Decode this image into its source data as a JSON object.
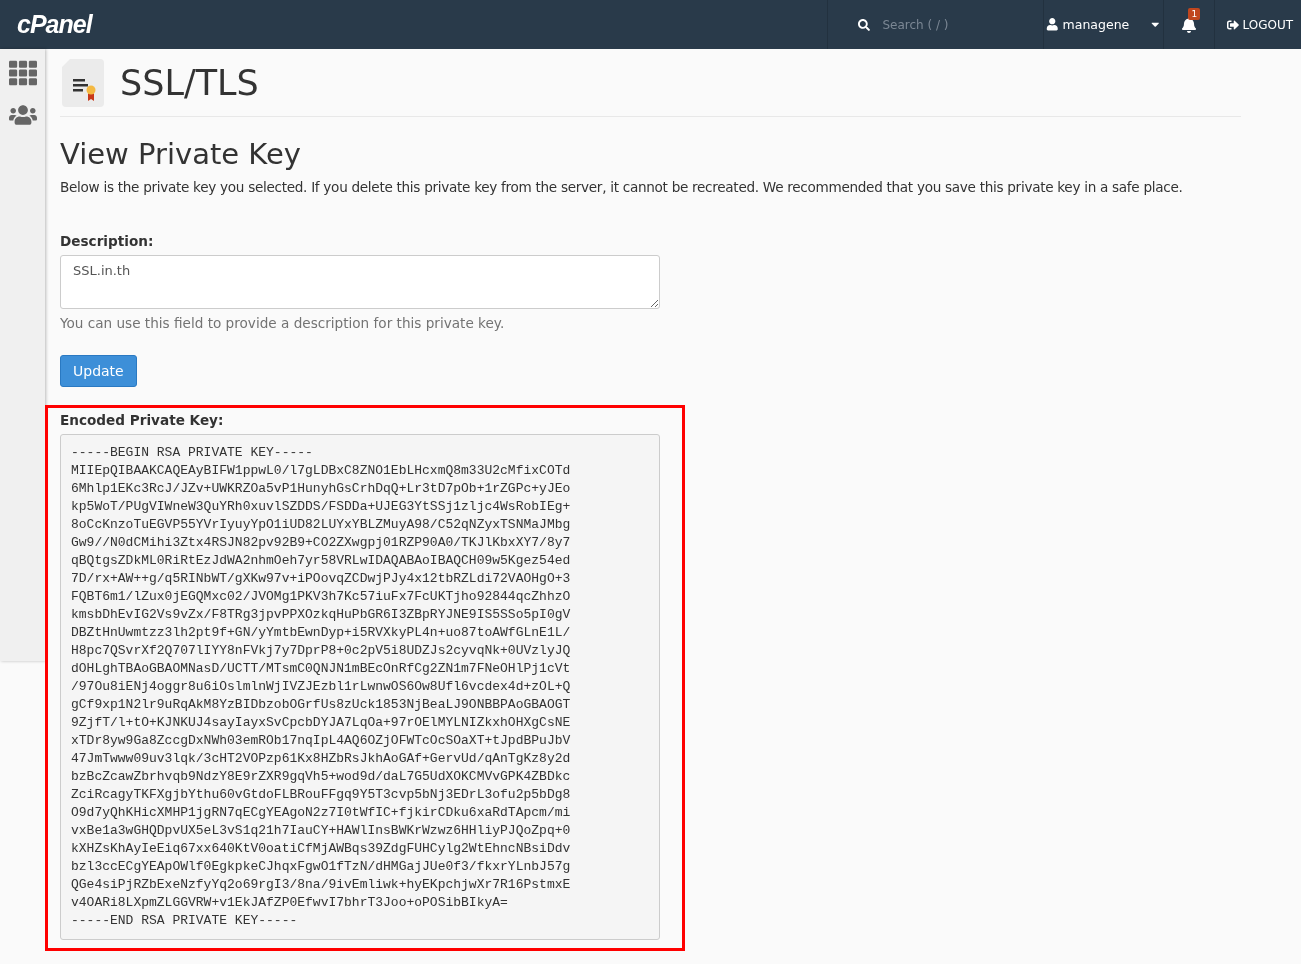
{
  "header": {
    "logo": "cPanel",
    "search": {
      "placeholder": "Search ( / )"
    },
    "user": "managene",
    "notifications": "1",
    "logout": "LOGOUT"
  },
  "sidebar": {
    "items": [
      {
        "kind": "grid",
        "selected": false
      },
      {
        "kind": "users",
        "selected": false
      }
    ]
  },
  "page": {
    "title": "SSL/TLS"
  },
  "section": {
    "title": "View Private Key",
    "intro": "Below is the private key you selected. If you delete this private key from the server, it cannot be recreated. We recommended that you save this private key in a safe place."
  },
  "description": {
    "label": "Description:",
    "value": "SSL.in.th",
    "help": "You can use this field to provide a description for this private key."
  },
  "update_button": "Update",
  "encoded_key": {
    "label": "Encoded Private Key:",
    "highlighted": true,
    "lines": [
      "-----BEGIN RSA PRIVATE KEY-----",
      "MIIEpQIBAAKCAQEAyBIFW1ppwL0/l7gLDBxC8ZNO1EbLHcxmQ8m33U2cMfixCOTd",
      "6Mhlp1EKc3RcJ/JZv+UWKRZOa5vP1HunyhGsCrhDqQ+Lr3tD7pOb+1rZGPc+yJEo",
      "kp5WoT/PUgVIWneW3QuYRh0xuvlSZDDS/FSDDa+UJEG3YtSSj1zljc4WsRobIEg+",
      "8oCcKnzoTuEGVP55YVrIyuyYpO1iUD82LUYxYBLZMuyA98/C52qNZyxTSNMaJMbg",
      "Gw9//N0dCMihi3Ztx4RSJN82pv92B9+CO2ZXwgpj01RZP90A0/TKJlKbxXY7/8y7",
      "qBQtgsZDkML0RiRtEzJdWA2nhmOeh7yr58VRLwIDAQABAoIBAQCH09w5Kgez54ed",
      "7D/rx+AW++g/q5RINbWT/gXKw97v+iPOovqZCDwjPJy4x12tbRZLdi72VAOHgO+3",
      "FQBT6m1/lZux0jEGQMxc02/JVOMg1PKV3h7Kc57iuFx7FcUKTjho92844qcZhhzO",
      "kmsbDhEvIG2Vs9vZx/F8TRg3jpvPPXOzkqHuPbGR6I3ZBpRYJNE9IS5SSo5pI0gV",
      "DBZtHnUwmtzz3lh2pt9f+GN/yYmtbEwnDyp+i5RVXkyPL4n+uo87toAWfGLnE1L/",
      "H8pc7QSvrXf2Q707lIYY8nFVkj7y7DprP8+0c2pV5i8UDZJs2cyvqNk+0UVzlyJQ",
      "dOHLghTBAoGBAOMNasD/UCTT/MTsmC0QNJN1mBEcOnRfCg2ZN1m7FNeOHlPj1cVt",
      "/97Ou8iENj4oggr8u6iOslmlnWjIVZJEzbl1rLwnwOS6Ow8Ufl6vcdex4d+zOL+Q",
      "gCf9xp1N2lr9uRqAkM8YzBIDbzobOGrfUs8zUck1853NjBeaLJ9ONBBPAoGBAOGT",
      "9ZjfT/l+tO+KJNKUJ4sayIayxSvCpcbDYJA7LqOa+97rOElMYLNIZkxhOHXgCsNE",
      "xTDr8yw9Ga8ZccgDxNWh03emROb17nqIpL4AQ6OZjOFWTcOcSOaXT+tJpdBPuJbV",
      "47JmTwww09uv3lqk/3cHT2VOPzp61Kx8HZbRsJkhAoGAf+GervUd/qAnTgKz8y2d",
      "bzBcZcawZbrhvqb9NdzY8E9rZXR9gqVh5+wod9d/daL7G5UdXOKCMVvGPK4ZBDkc",
      "ZciRcagyTKFXgjbYthu60vGtdoFLBRouFFgq9Y5T3cvp5bNj3EDrL3ofu2p5bDg8",
      "O9d7yQhKHicXMHP1jgRN7qECgYEAgoN2z7I0tWfIC+fjkirCDku6xaRdTApcm/mi",
      "vxBe1a3wGHQDpvUX5eL3vS1q21h7IauCY+HAWlInsBWKrWzwz6HHliyPJQoZpq+0",
      "kXHZsKhAyIeEiq67xx640KtV0oatiCfMjAWBqs39ZdgFUHCylg2WtEhncNBsiDdv",
      "bzl3ccECgYEApOWlf0EgkpkeCJhqxFgwO1fTzN/dHMGajJUe0f3/fkxrYLnbJ57g",
      "QGe4siPjRZbExeNzfyYq2o69rgI3/8na/9ivEmliwk+hyEKpchjwXr7R16PstmxE",
      "v4OARi8LXpmZLGGVRW+v1EkJAfZP0EfwvI7bhrT3Joo+oPOSibBIkyA=",
      "-----END RSA PRIVATE KEY-----"
    ]
  }
}
